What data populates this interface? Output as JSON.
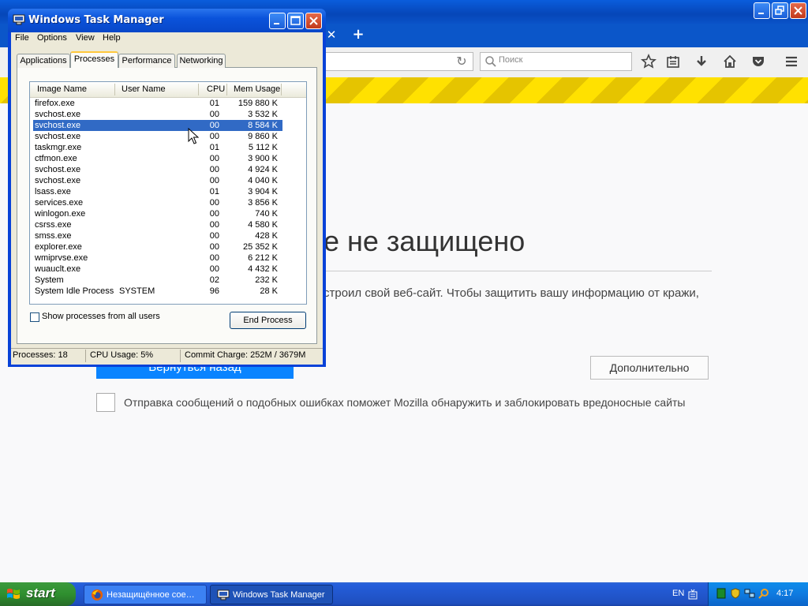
{
  "firefox": {
    "search_placeholder": "Поиск",
    "heading": "е не защищено",
    "description": "строил свой веб-сайт. Чтобы защитить вашу информацию от кражи,",
    "back_button": "Вернуться назад",
    "advanced_button": "Дополнительно",
    "report_text": "Отправка сообщений о подобных ошибках поможет Mozilla обнаружить и заблокировать вредоносные сайты",
    "colors": {
      "warning_stripe": "#ffe100",
      "accent": "#0a84ff"
    }
  },
  "taskmanager": {
    "title": "Windows Task Manager",
    "menu": [
      "File",
      "Options",
      "View",
      "Help"
    ],
    "tabs": [
      "Applications",
      "Processes",
      "Performance",
      "Networking"
    ],
    "active_tab": "Processes",
    "columns": [
      "Image Name",
      "User Name",
      "CPU",
      "Mem Usage"
    ],
    "processes": [
      {
        "name": "firefox.exe",
        "user": "",
        "cpu": "01",
        "mem": "159 880 K"
      },
      {
        "name": "svchost.exe",
        "user": "",
        "cpu": "00",
        "mem": "3 532 K"
      },
      {
        "name": "svchost.exe",
        "user": "",
        "cpu": "00",
        "mem": "8 584 K",
        "selected": true
      },
      {
        "name": "svchost.exe",
        "user": "",
        "cpu": "00",
        "mem": "9 860 K"
      },
      {
        "name": "taskmgr.exe",
        "user": "",
        "cpu": "01",
        "mem": "5 112 K"
      },
      {
        "name": "ctfmon.exe",
        "user": "",
        "cpu": "00",
        "mem": "3 900 K"
      },
      {
        "name": "svchost.exe",
        "user": "",
        "cpu": "00",
        "mem": "4 924 K"
      },
      {
        "name": "svchost.exe",
        "user": "",
        "cpu": "00",
        "mem": "4 040 K"
      },
      {
        "name": "lsass.exe",
        "user": "",
        "cpu": "01",
        "mem": "3 904 K"
      },
      {
        "name": "services.exe",
        "user": "",
        "cpu": "00",
        "mem": "3 856 K"
      },
      {
        "name": "winlogon.exe",
        "user": "",
        "cpu": "00",
        "mem": "740 K"
      },
      {
        "name": "csrss.exe",
        "user": "",
        "cpu": "00",
        "mem": "4 580 K"
      },
      {
        "name": "smss.exe",
        "user": "",
        "cpu": "00",
        "mem": "428 K"
      },
      {
        "name": "explorer.exe",
        "user": "",
        "cpu": "00",
        "mem": "25 352 K"
      },
      {
        "name": "wmiprvse.exe",
        "user": "",
        "cpu": "00",
        "mem": "6 212 K"
      },
      {
        "name": "wuauclt.exe",
        "user": "",
        "cpu": "00",
        "mem": "4 432 K"
      },
      {
        "name": "System",
        "user": "",
        "cpu": "02",
        "mem": "232 K"
      },
      {
        "name": "System Idle Process",
        "user": "SYSTEM",
        "cpu": "96",
        "mem": "28 K"
      }
    ],
    "show_all_label": "Show processes from all users",
    "end_process_label": "End Process",
    "status": {
      "processes": "Processes: 18",
      "cpu": "CPU Usage: 5%",
      "commit": "Commit Charge: 252M / 3679M"
    },
    "colors": {
      "selection": "#316ac5",
      "titlebar": "#0a53db"
    }
  },
  "taskbar": {
    "start_label": "start",
    "tasks": [
      {
        "label": "Незащищённое сое…",
        "icon": "firefox-icon"
      },
      {
        "label": "Windows Task Manager",
        "icon": "taskmanager-icon"
      }
    ],
    "language": "EN",
    "clock": "4:17"
  }
}
